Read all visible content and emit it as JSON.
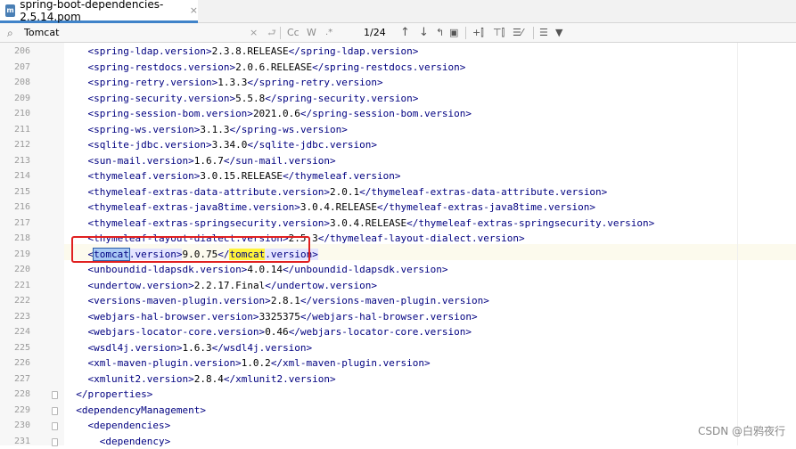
{
  "tab": {
    "file_type": "m",
    "filename": "spring-boot-dependencies-2.5.14.pom",
    "close_icon": "×"
  },
  "search": {
    "search_icon": "⌕",
    "query": "Tomcat",
    "clear_icon": "×",
    "replace_icon": "⮐",
    "match_case": "Cc",
    "words": "W",
    "regex": ".*",
    "count": "1/24",
    "prev_icon": "↑",
    "next_icon": "↓",
    "select_all_icon": "↰",
    "context_icon": "▣",
    "add_cursor_icon": "+⫿",
    "filter_icon": "⊤⫿",
    "in_selection_icon": "☰⁄",
    "sort_icon": "☰",
    "funnel_icon": "▼"
  },
  "lines": [
    {
      "num": "206",
      "indent": "  ",
      "tag": "spring-ldap.version",
      "value": "2.3.8.RELEASE"
    },
    {
      "num": "207",
      "indent": "  ",
      "tag": "spring-restdocs.version",
      "value": "2.0.6.RELEASE"
    },
    {
      "num": "208",
      "indent": "  ",
      "tag": "spring-retry.version",
      "value": "1.3.3"
    },
    {
      "num": "209",
      "indent": "  ",
      "tag": "spring-security.version",
      "value": "5.5.8"
    },
    {
      "num": "210",
      "indent": "  ",
      "tag": "spring-session-bom.version",
      "value": "2021.0.6"
    },
    {
      "num": "211",
      "indent": "  ",
      "tag": "spring-ws.version",
      "value": "3.1.3"
    },
    {
      "num": "212",
      "indent": "  ",
      "tag": "sqlite-jdbc.version",
      "value": "3.34.0"
    },
    {
      "num": "213",
      "indent": "  ",
      "tag": "sun-mail.version",
      "value": "1.6.7"
    },
    {
      "num": "214",
      "indent": "  ",
      "tag": "thymeleaf.version",
      "value": "3.0.15.RELEASE"
    },
    {
      "num": "215",
      "indent": "  ",
      "tag": "thymeleaf-extras-data-attribute.version",
      "value": "2.0.1"
    },
    {
      "num": "216",
      "indent": "  ",
      "tag": "thymeleaf-extras-java8time.version",
      "value": "3.0.4.RELEASE"
    },
    {
      "num": "217",
      "indent": "  ",
      "tag": "thymeleaf-extras-springsecurity.version",
      "value": "3.0.4.RELEASE"
    },
    {
      "num": "218",
      "indent": "  ",
      "tag": "thymeleaf-layout-dialect.version",
      "value": "2.5.3"
    },
    {
      "num": "219",
      "indent": "  ",
      "special": true
    },
    {
      "num": "220",
      "indent": "  ",
      "tag": "unboundid-ldapsdk.version",
      "value": "4.0.14"
    },
    {
      "num": "221",
      "indent": "  ",
      "tag": "undertow.version",
      "value": "2.2.17.Final"
    },
    {
      "num": "222",
      "indent": "  ",
      "tag": "versions-maven-plugin.version",
      "value": "2.8.1"
    },
    {
      "num": "223",
      "indent": "  ",
      "tag": "webjars-hal-browser.version",
      "value": "3325375"
    },
    {
      "num": "224",
      "indent": "  ",
      "tag": "webjars-locator-core.version",
      "value": "0.46"
    },
    {
      "num": "225",
      "indent": "  ",
      "tag": "wsdl4j.version",
      "value": "1.6.3"
    },
    {
      "num": "226",
      "indent": "  ",
      "tag": "xml-maven-plugin.version",
      "value": "1.0.2"
    },
    {
      "num": "227",
      "indent": "  ",
      "tag": "xmlunit2.version",
      "value": "2.8.4"
    },
    {
      "num": "228",
      "indent": "",
      "raw": "</properties>"
    },
    {
      "num": "229",
      "indent": "",
      "raw": "<dependencyManagement>"
    },
    {
      "num": "230",
      "indent": "  ",
      "raw": "<dependencies>"
    },
    {
      "num": "231",
      "indent": "    ",
      "raw": "<dependency>"
    }
  ],
  "tomcat_line": {
    "open_lt": "<",
    "match1": "tomcat",
    "open_rest": ".version>",
    "value": "9.0.75",
    "close_lt": "</",
    "match2": "tomcat",
    "close_rest": ".version>"
  },
  "watermark": "CSDN @白鸦夜行",
  "colors": {
    "tag": "#000080",
    "selection": "#a9c9f5",
    "find_highlight": "#fff33a",
    "annotation_box": "#e02020"
  }
}
